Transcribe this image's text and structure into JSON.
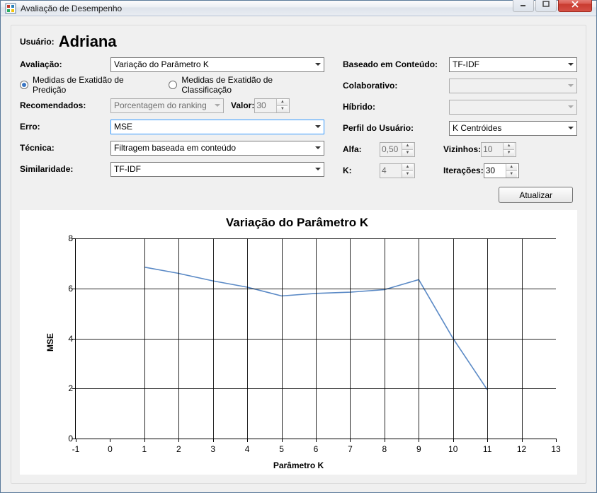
{
  "window": {
    "title": "Avaliação de Desempenho"
  },
  "user": {
    "label": "Usuário:",
    "name": "Adriana"
  },
  "left": {
    "avaliacao_label": "Avaliação:",
    "avaliacao_value": "Variação do Parâmetro K",
    "radio_predicao": "Medidas de Exatidão de Predição",
    "radio_classificacao": "Medidas de Exatidão de Classificação",
    "recomendados_label": "Recomendados:",
    "recomendados_value": "Porcentagem do ranking",
    "valor_label": "Valor:",
    "valor_value": "30",
    "erro_label": "Erro:",
    "erro_value": "MSE",
    "tecnica_label": "Técnica:",
    "tecnica_value": "Filtragem baseada em conteúdo",
    "similaridade_label": "Similaridade:",
    "similaridade_value": "TF-IDF"
  },
  "right": {
    "baseado_label": "Baseado em Conteúdo:",
    "baseado_value": "TF-IDF",
    "colaborativo_label": "Colaborativo:",
    "colaborativo_value": "",
    "hibrido_label": "Híbrido:",
    "hibrido_value": "",
    "perfil_label": "Perfil do Usuário:",
    "perfil_value": "K Centróides",
    "alfa_label": "Alfa:",
    "alfa_value": "0,50",
    "vizinhos_label": "Vizinhos:",
    "vizinhos_value": "10",
    "k_label": "K:",
    "k_value": "4",
    "iteracoes_label": "Iterações:",
    "iteracoes_value": "30"
  },
  "button": {
    "atualizar": "Atualizar"
  },
  "chart_data": {
    "type": "line",
    "title": "Variação do Parâmetro K",
    "xlabel": "Parâmetro K",
    "ylabel": "MSE",
    "x_ticks": [
      -1,
      0,
      1,
      2,
      3,
      4,
      5,
      6,
      7,
      8,
      9,
      10,
      11,
      12,
      13
    ],
    "y_ticks": [
      0,
      2,
      4,
      6,
      8
    ],
    "xlim": [
      -1,
      13
    ],
    "ylim": [
      0,
      8
    ],
    "x": [
      1,
      2,
      3,
      4,
      5,
      6,
      7,
      8,
      9,
      10,
      11
    ],
    "y": [
      6.85,
      6.6,
      6.3,
      6.05,
      5.7,
      5.8,
      5.85,
      5.95,
      6.35,
      4.0,
      1.95
    ]
  }
}
